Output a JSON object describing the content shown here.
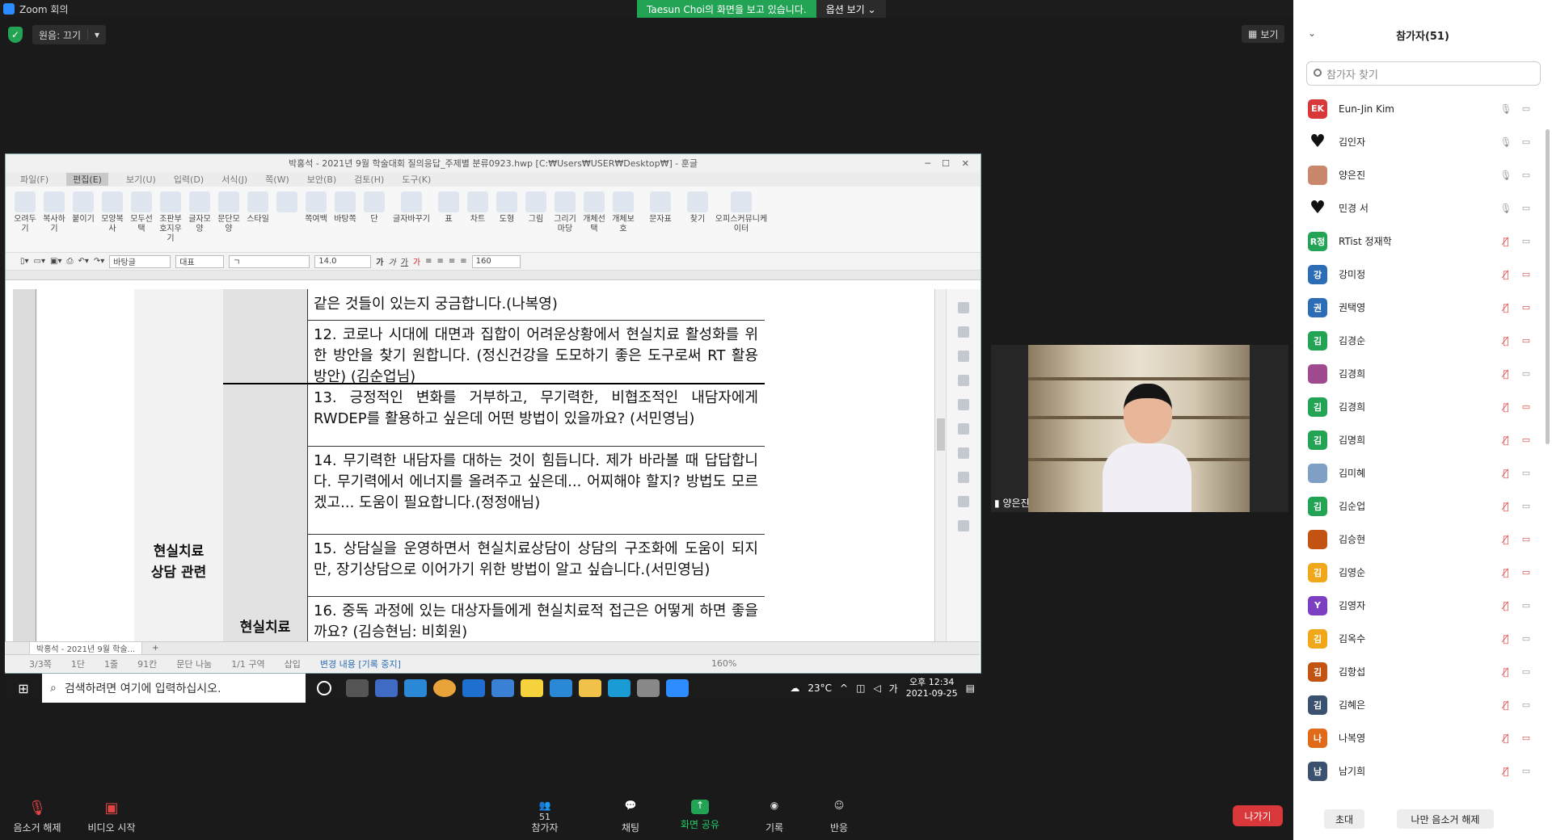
{
  "zoom": {
    "window_title": "Zoom 회의",
    "share_banner": "Taesun Choi의 화면을 보고 있습니다.",
    "view_options": "옵션 보기 ⌄",
    "original_sound": "원음: 끄기",
    "view_label": "보기",
    "video_name": "양은진",
    "leave": "나가기",
    "bottom": {
      "unmute": "음소거 해제",
      "start_video": "비디오 시작",
      "participants": "참가자",
      "participants_count": "51",
      "chat": "채팅",
      "share": "화면 공유",
      "record": "기록",
      "reactions": "반응"
    }
  },
  "panel": {
    "title": "참가자(51)",
    "search_placeholder": "참가자 찾기",
    "invite": "초대",
    "unmute_self": "나만 음소거 해제",
    "participants": [
      {
        "initials": "EK",
        "name": "Eun-Jin Kim",
        "color": "#d9383a",
        "mic": "on",
        "cam": "on"
      },
      {
        "initials": "♥",
        "name": "김인자",
        "color": "#111111",
        "mic": "on",
        "cam": "on"
      },
      {
        "initials": "",
        "name": "양은진",
        "color": "#c9876b",
        "mic": "on",
        "cam": "on"
      },
      {
        "initials": "♥",
        "name": "민경 서",
        "color": "#111111",
        "mic": "on",
        "cam": "on"
      },
      {
        "initials": "R정",
        "name": "RTist 정재학",
        "color": "#23a455",
        "mic": "muted",
        "cam": "on"
      },
      {
        "initials": "강",
        "name": "강미정",
        "color": "#2d6db5",
        "mic": "muted",
        "cam": "off"
      },
      {
        "initials": "권",
        "name": "권택영",
        "color": "#2d6db5",
        "mic": "muted",
        "cam": "off"
      },
      {
        "initials": "김",
        "name": "김경순",
        "color": "#23a455",
        "mic": "muted",
        "cam": "off"
      },
      {
        "initials": "",
        "name": "김경희",
        "color": "#a04a8f",
        "mic": "muted",
        "cam": "on"
      },
      {
        "initials": "김",
        "name": "김경희",
        "color": "#23a455",
        "mic": "muted",
        "cam": "off"
      },
      {
        "initials": "김",
        "name": "김명희",
        "color": "#23a455",
        "mic": "muted",
        "cam": "off"
      },
      {
        "initials": "",
        "name": "김미혜",
        "color": "#7f9fc4",
        "mic": "muted",
        "cam": "on"
      },
      {
        "initials": "김",
        "name": "김순업",
        "color": "#23a455",
        "mic": "muted",
        "cam": "on"
      },
      {
        "initials": "",
        "name": "김승현",
        "color": "#c25312",
        "mic": "muted",
        "cam": "off"
      },
      {
        "initials": "김",
        "name": "김영순",
        "color": "#f0a81a",
        "mic": "muted",
        "cam": "off"
      },
      {
        "initials": "Y",
        "name": "김영자",
        "color": "#7c3fc1",
        "mic": "muted",
        "cam": "on"
      },
      {
        "initials": "김",
        "name": "김옥수",
        "color": "#f0a81a",
        "mic": "muted",
        "cam": "on"
      },
      {
        "initials": "김",
        "name": "김항섭",
        "color": "#c25312",
        "mic": "muted",
        "cam": "on"
      },
      {
        "initials": "김",
        "name": "김혜은",
        "color": "#3a5270",
        "mic": "muted",
        "cam": "on"
      },
      {
        "initials": "나",
        "name": "나복영",
        "color": "#e06a1a",
        "mic": "muted",
        "cam": "off"
      },
      {
        "initials": "남",
        "name": "남기희",
        "color": "#3a5270",
        "mic": "muted",
        "cam": "on"
      }
    ]
  },
  "hwp": {
    "title": "박홍석 - 2021년 9월 학술대회 질의응답_주제별 분류0923.hwp [C:₩Users₩USER₩Desktop₩] - 훈글",
    "menu": [
      "파일(F)",
      "편집(E)",
      "보기(U)",
      "입력(D)",
      "서식(J)",
      "쪽(W)",
      "보안(B)",
      "검토(H)",
      "도구(K)"
    ],
    "ribbon": [
      "오려두기",
      "복사하기",
      "붙이기",
      "모양복사",
      "모두선택",
      "조판부호지우기",
      "글자모양",
      "문단모양",
      "스타일",
      "",
      "쪽여백",
      "바탕쪽",
      "단",
      "글자바꾸기",
      "표",
      "차트",
      "도형",
      "그림",
      "그리기마당",
      "개체선택",
      "개체보호",
      "문자표",
      "찾기",
      "오피스커뮤니케이터"
    ],
    "style_box": "바탕글",
    "para_box": "대표",
    "font_size": "14.0",
    "zoom_box": "160",
    "category_main": "현실치료\n상담 관련",
    "category_sub": "현실치료",
    "questions": [
      "같은 것들이 있는지 궁금합니다.(나복영)",
      "12. 코로나 시대에 대면과 집합이 어려운상황에서 현실치료 활성화를 위한 방안을 찾기 원합니다. (정신건강을 도모하기 좋은 도구로써 RT 활용방안) (김순업님)",
      "13. 긍정적인 변화를 거부하고, 무기력한, 비협조적인 내담자에게 RWDEP를 활용하고 싶은데 어떤 방법이 있을까요? (서민영님)",
      "14. 무기력한 내담자를 대하는 것이 힘듭니다. 제가 바라볼 때 답답합니다. 무기력에서 에너지를 올려주고 싶은데... 어찌해야 할지? 방법도 모르겠고... 도움이 필요합니다.(정정애님)",
      "15. 상담실을 운영하면서 현실치료상담이 상담의 구조화에 도움이 되지만, 장기상담으로 이어가기 위한 방법이 알고 싶습니다.(서민영님)",
      "16. 중독 과정에 있는 대상자들에게 현실치료적 접근은 어떻게 하면 좋을까요? (김승현님: 비회원)"
    ],
    "tab_label": "박홍석 - 2021년 9월 학술...",
    "status": [
      "3/3쪽",
      "1단",
      "1줄",
      "91칸",
      "문단 나눔",
      "1/1 구역",
      "삽입",
      "변경 내용 [기록 중지]",
      "160%"
    ]
  },
  "taskbar": {
    "search": "검색하려면 여기에 입력하십시오.",
    "temp": "23°C",
    "ime": "가",
    "time": "오후 12:34",
    "date": "2021-09-25"
  }
}
